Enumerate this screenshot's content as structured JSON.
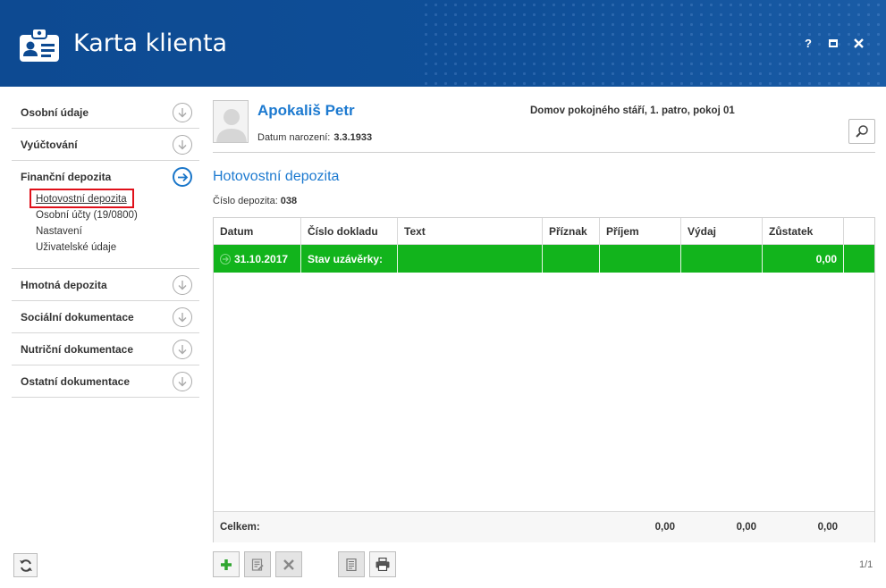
{
  "window": {
    "title": "Karta klienta",
    "help_label": "?"
  },
  "sidebar": {
    "items": [
      {
        "label": "Osobní údaje"
      },
      {
        "label": "Vyúčtování"
      },
      {
        "label": "Finanční depozita"
      },
      {
        "label": "Hmotná depozita"
      },
      {
        "label": "Sociální dokumentace"
      },
      {
        "label": "Nutriční dokumentace"
      },
      {
        "label": "Ostatní dokumentace"
      }
    ],
    "subitems": [
      {
        "label": "Hotovostní depozita"
      },
      {
        "label": "Osobní účty (19/0800)"
      },
      {
        "label": "Nastavení"
      },
      {
        "label": "Uživatelské údaje"
      }
    ]
  },
  "client": {
    "name": "Apokališ Petr",
    "birth_label": "Datum narození:",
    "birth_date": "3.3.1933",
    "location": "Domov pokojného stáří, 1. patro, pokoj 01"
  },
  "section": {
    "title": "Hotovostní depozita",
    "deposit_label": "Číslo depozita:",
    "deposit_number": "038"
  },
  "table": {
    "columns": [
      "Datum",
      "Číslo dokladu",
      "Text",
      "Příznak",
      "Příjem",
      "Výdaj",
      "Zůstatek"
    ],
    "rows": [
      {
        "date": "31.10.2017",
        "doc": "Stav uzávěrky:",
        "text": "",
        "flag": "",
        "income": "",
        "expense": "",
        "balance": "0,00"
      }
    ],
    "footer": {
      "label": "Celkem:",
      "income": "0,00",
      "expense": "0,00",
      "balance": "0,00"
    }
  },
  "pager": "1/1",
  "colors": {
    "header_blue": "#0d4a92",
    "accent_blue": "#1d7ad0",
    "row_green": "#12b41c",
    "selection_red": "#e0101a"
  }
}
